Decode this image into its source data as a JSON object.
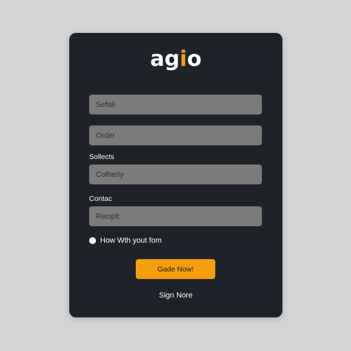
{
  "brand": {
    "logo_main": "ag",
    "logo_accent": "i",
    "logo_end": "o",
    "accent_color": "#f59e0b"
  },
  "form": {
    "field1_placeholder": "Sefall",
    "field2_placeholder": "Order",
    "section1_label": "Sollects",
    "field3_placeholder": "Colherly",
    "section2_label": "Contac",
    "field4_placeholder": "Recipit",
    "radio_label": "How Wth yout fom",
    "radio_selected": true
  },
  "actions": {
    "primary_label": "Gade Now!",
    "link_label": "Sign Nore"
  },
  "colors": {
    "page_background": "#d3d4d6",
    "card_background": "#1f2329",
    "field_background": "#7b7b7b"
  }
}
